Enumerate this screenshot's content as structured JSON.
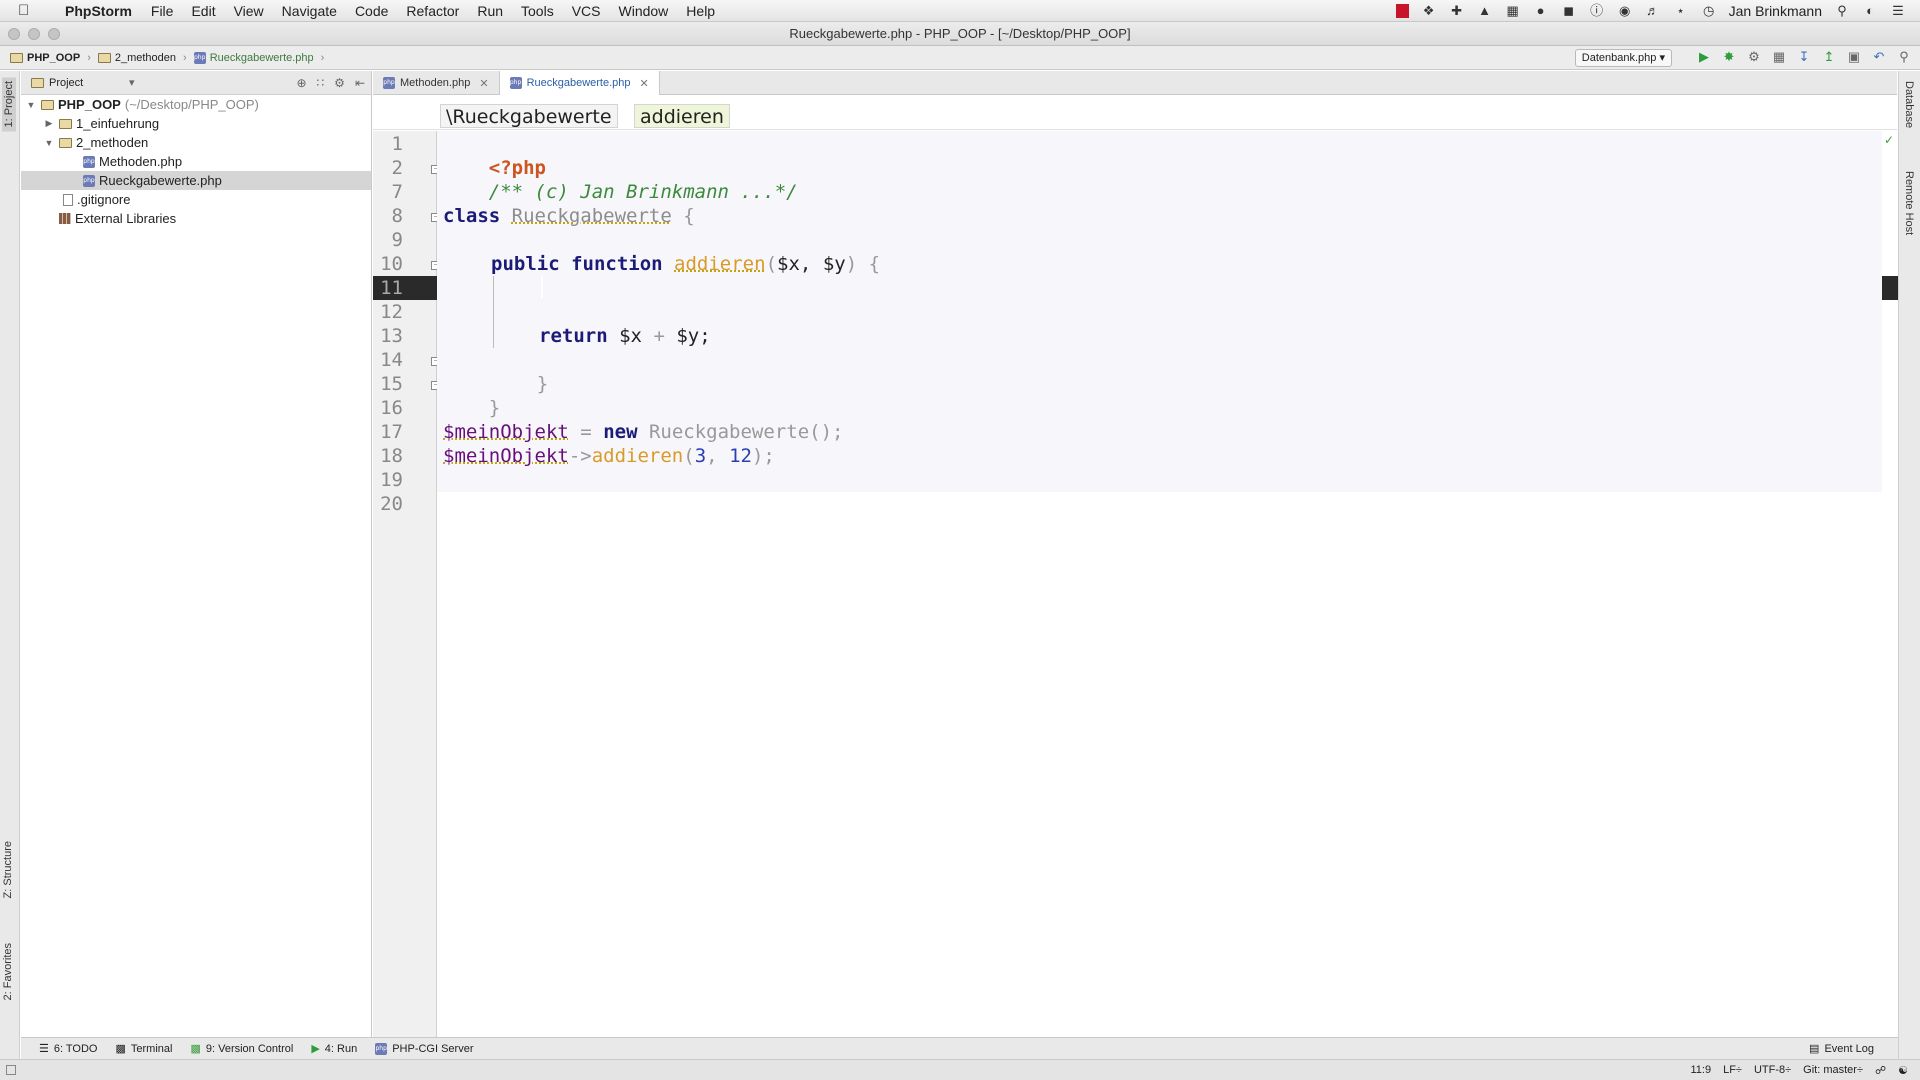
{
  "menubar": {
    "app_name": "PhpStorm",
    "items": [
      "File",
      "Edit",
      "View",
      "Navigate",
      "Code",
      "Refactor",
      "Run",
      "Tools",
      "VCS",
      "Window",
      "Help"
    ],
    "user": "Jan Brinkmann"
  },
  "window": {
    "title": "Rueckgabewerte.php - PHP_OOP - [~/Desktop/PHP_OOP]"
  },
  "navbar": {
    "crumbs": [
      "PHP_OOP",
      "2_methoden",
      "Rueckgabewerte.php"
    ],
    "run_config": "Datenbank.php"
  },
  "project_panel": {
    "header": "Project",
    "tree": [
      {
        "label": "PHP_OOP",
        "hint": "(~/Desktop/PHP_OOP)"
      },
      {
        "label": "1_einfuehrung"
      },
      {
        "label": "2_methoden"
      },
      {
        "label": "Methoden.php"
      },
      {
        "label": "Rueckgabewerte.php"
      },
      {
        "label": ".gitignore"
      },
      {
        "label": "External Libraries"
      }
    ]
  },
  "left_tool_windows": [
    "1: Project",
    "Z: Structure",
    "2: Favorites"
  ],
  "right_tool_windows": [
    "Database",
    "Remote Host"
  ],
  "tabs": [
    {
      "label": "Methoden.php"
    },
    {
      "label": "Rueckgabewerte.php"
    }
  ],
  "editor_breadcrumbs": [
    "\\Rueckgabewerte",
    "addieren"
  ],
  "line_numbers": [
    "1",
    "2",
    "7",
    "8",
    "9",
    "10",
    "11",
    "12",
    "13",
    "14",
    "15",
    "16",
    "17",
    "18",
    "19",
    "20"
  ],
  "code": {
    "l1": "<?php",
    "l2": "/** (c) Jan Brinkmann ...*/",
    "l8_kw": "class",
    "l8_name": "Rueckgabewerte",
    "l8_brace": "{",
    "l10_kw": "public function",
    "l10_fn": "addieren",
    "l10_open": "(",
    "l10_p1": "$x",
    "l10_comma": ",",
    "l10_p2": "$y",
    "l10_close": ") {",
    "l13_kw": "return",
    "l13_a": "$x",
    "l13_op": "+",
    "l13_b": "$y",
    "l13_end": ";",
    "l14": "}",
    "l15": "}",
    "l17_var": "$meinObjekt",
    "l17_eq": "=",
    "l17_kw": "new",
    "l17_cls": "Rueckgabewerte",
    "l17_end": "();",
    "l18_var": "$meinObjekt",
    "l18_arrow": "->",
    "l18_fn": "addieren",
    "l18_open": "(",
    "l18_a": "3",
    "l18_comma": ",",
    "l18_b": "12",
    "l18_end": ");"
  },
  "bottom_tools": [
    "6: TODO",
    "Terminal",
    "9: Version Control",
    "4: Run",
    "PHP-CGI Server"
  ],
  "event_log": "Event Log",
  "status": {
    "position": "11:9",
    "line_sep": "LF÷",
    "encoding": "UTF-8÷",
    "git": "Git: master÷"
  },
  "colors": {
    "keyword": "#000080",
    "php_tag": "#cc5520",
    "comment": "#3d8a3d",
    "function": "#d99a2a",
    "variable": "#660e7a",
    "number": "#2a3fb0",
    "current_line": "#2a2a2a"
  },
  "icons": [
    "apple-icon",
    "play-icon",
    "debug-icon",
    "search-icon",
    "folder-icon",
    "php-file-icon",
    "close-icon"
  ]
}
